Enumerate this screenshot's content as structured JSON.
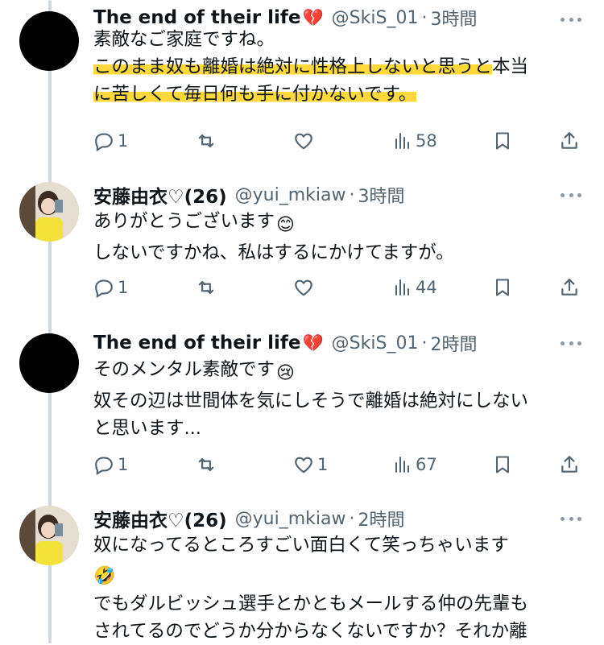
{
  "tweets": [
    {
      "name": "The end of their life",
      "name_emoji": "💔",
      "handle": "@SkiS_01",
      "dot": "·",
      "time": "3時間",
      "lines": [
        "素敵なご家庭ですね。",
        "このまま奴も離婚は絶対に性格上しないと思うと",
        "本当",
        "に苦しくて毎日何も手に付かないです。"
      ],
      "reply_count": "1",
      "retweet_count": "",
      "like_count": "",
      "view_count": "58",
      "avatar": "black-circle"
    },
    {
      "name": "安藤由衣♡(26)",
      "handle": "@yui_mkiaw",
      "dot": "·",
      "time": "3時間",
      "lines": [
        "ありがとうございます",
        "しないですかね、私はするにかけてますが。"
      ],
      "inline_emoji": "😊",
      "reply_count": "1",
      "retweet_count": "",
      "like_count": "",
      "view_count": "44",
      "avatar": "profile-photo"
    },
    {
      "name": "The end of their life",
      "name_emoji": "💔",
      "handle": "@SkiS_01",
      "dot": "·",
      "time": "2時間",
      "lines": [
        "そのメンタル素敵です",
        "奴その辺は世間体を気にしそうで離婚は絶対にしない",
        "と思います..."
      ],
      "inline_emoji": "😢",
      "reply_count": "1",
      "retweet_count": "",
      "like_count": "1",
      "view_count": "67",
      "avatar": "black-circle"
    },
    {
      "name": "安藤由衣♡(26)",
      "handle": "@yui_mkiaw",
      "dot": "·",
      "time": "2時間",
      "lines": [
        "奴になってるところすごい面白くて笑っちゃいます",
        "",
        "でもダルビッシュ選手とかともメールする仲の先輩も",
        "されてるのでどうか分からなくないですか？それか離"
      ],
      "inline_emoji": "🤣",
      "avatar": "profile-photo"
    }
  ],
  "icons": {
    "reply": "reply-icon",
    "retweet": "retweet-icon",
    "like": "heart-icon",
    "views": "views-icon",
    "bookmark": "bookmark-icon",
    "share": "share-icon",
    "more": "more-icon"
  },
  "colors": {
    "highlight": "#ffd93b",
    "secondary_text": "#536471",
    "thread_line": "#cfd9de"
  }
}
